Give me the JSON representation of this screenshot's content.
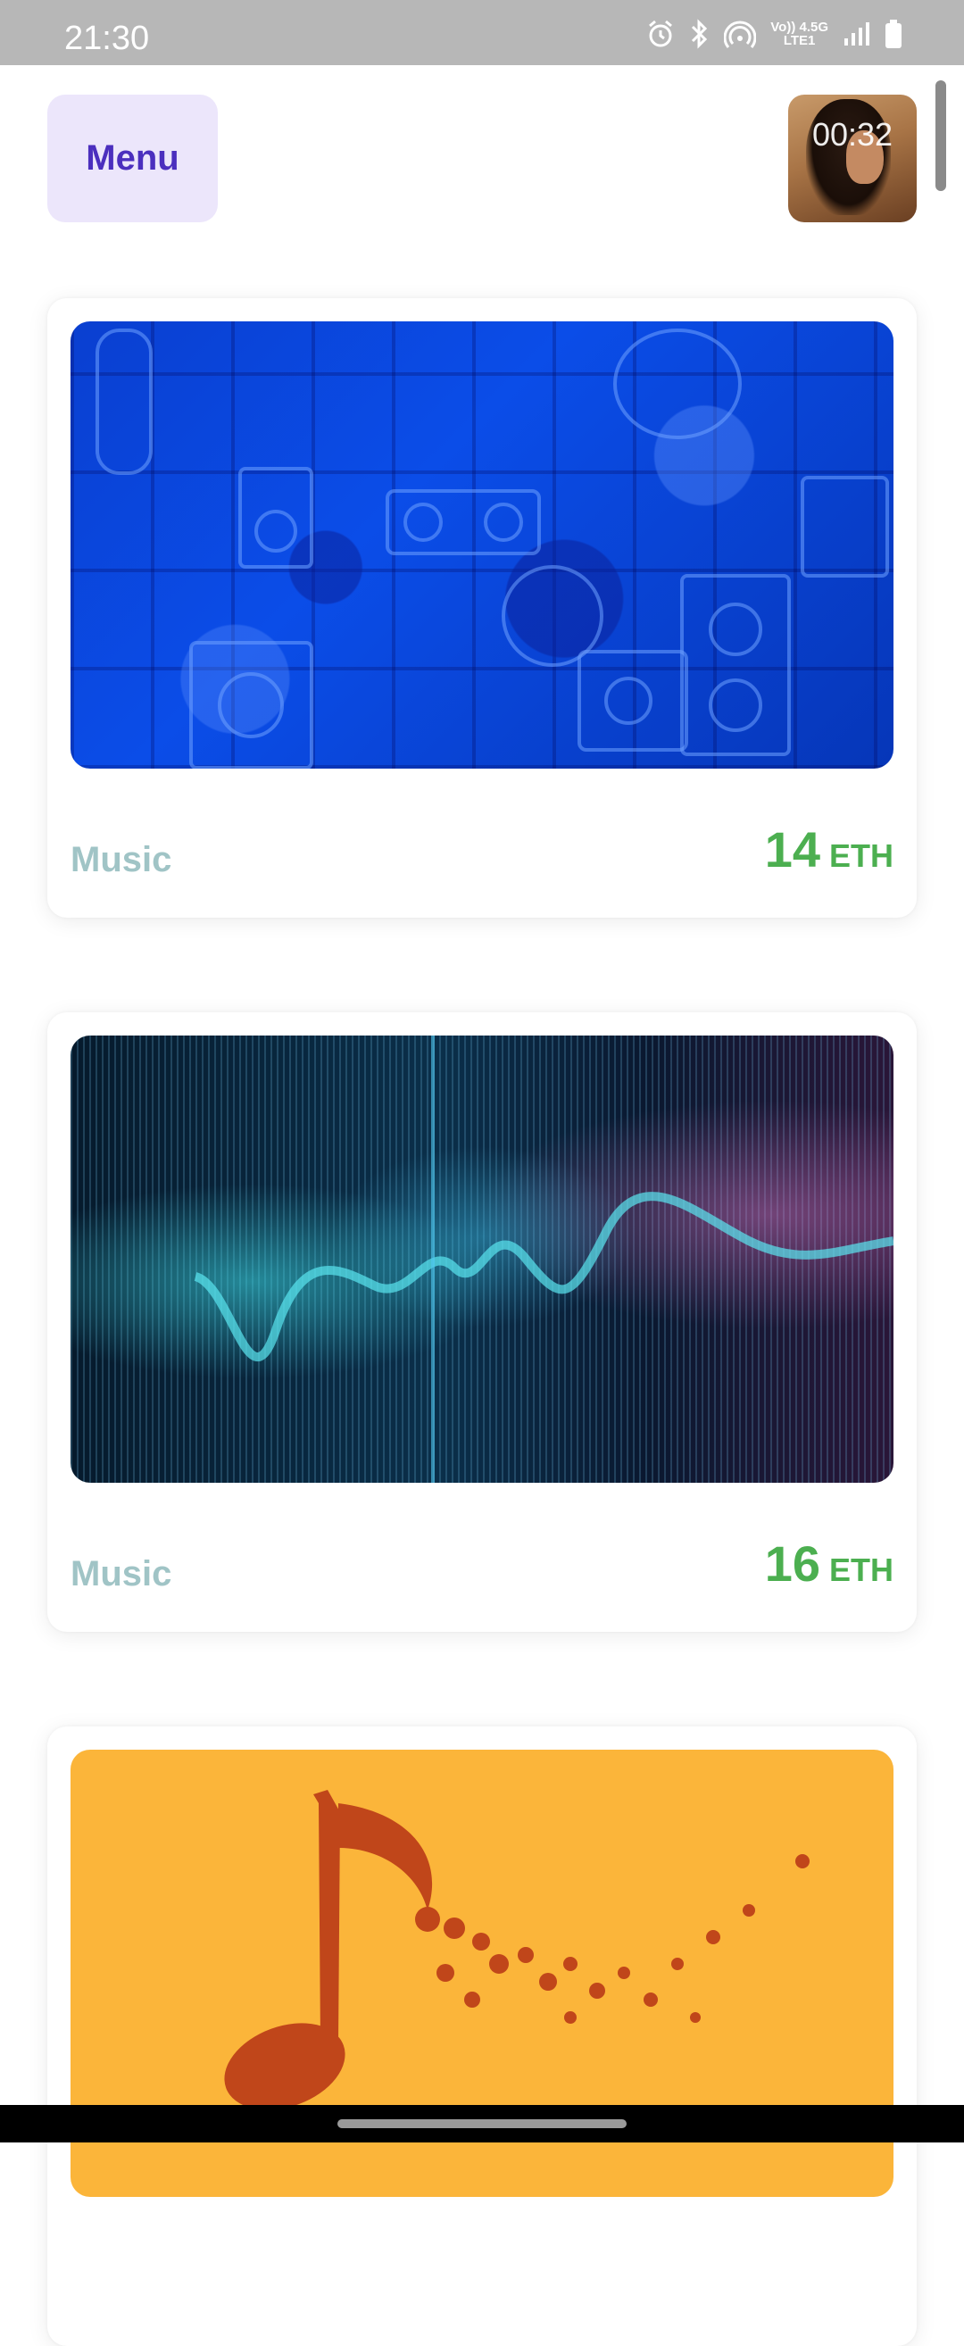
{
  "status_bar": {
    "time": "21:30",
    "network_top": "Vo)) 4.5G",
    "network_bottom": "LTE1",
    "icons": [
      "alarm-icon",
      "bluetooth-icon",
      "hotspot-icon",
      "signal-icon",
      "battery-icon"
    ]
  },
  "header": {
    "menu_label": "Menu",
    "video_timer": "00:32"
  },
  "cards": [
    {
      "category": "Music",
      "price": "14",
      "unit": "ETH",
      "image": "blue-instruments-wall"
    },
    {
      "category": "Music",
      "price": "16",
      "unit": "ETH",
      "image": "sound-wave"
    },
    {
      "image": "autumn-leaves-music-note"
    }
  ],
  "colors": {
    "accent": "#4b2fbe",
    "menu_bg": "#ece6fb",
    "price": "#4caf50",
    "category": "#a0c4c6"
  }
}
